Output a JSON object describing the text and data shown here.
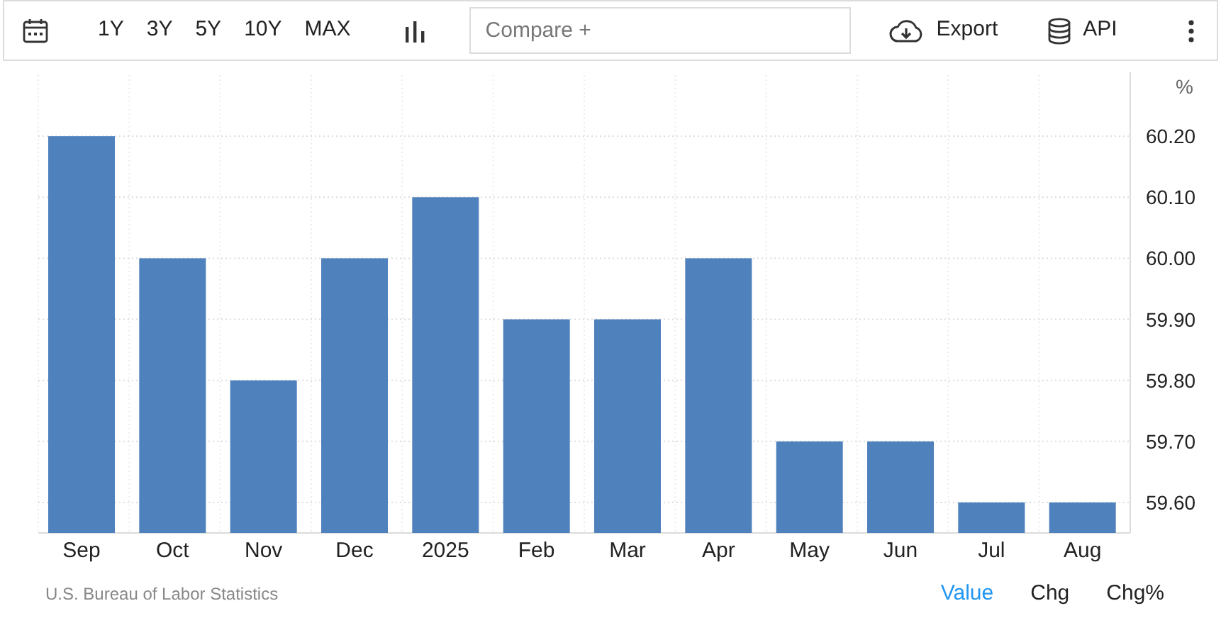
{
  "toolbar": {
    "ranges": [
      {
        "label": "1Y",
        "selected": false
      },
      {
        "label": "3Y",
        "selected": false
      },
      {
        "label": "5Y",
        "selected": false
      },
      {
        "label": "10Y",
        "selected": false
      },
      {
        "label": "MAX",
        "selected": false
      }
    ],
    "compare": {
      "placeholder": "Compare +"
    },
    "export": "Export",
    "api": "API"
  },
  "chart": {
    "unit": "%",
    "chart_data": {
      "type": "bar",
      "categories": [
        "Sep",
        "Oct",
        "Nov",
        "Dec",
        "2025",
        "Feb",
        "Mar",
        "Apr",
        "May",
        "Jun",
        "Jul",
        "Aug"
      ],
      "grid": true,
      "series": [
        {
          "color": "#4f81bd",
          "values": [
            60.2,
            60.0,
            59.8,
            60.0,
            60.1,
            59.9,
            59.9,
            60.0,
            59.7,
            59.7,
            59.6,
            59.6
          ]
        }
      ],
      "ylim": [
        59.55,
        60.3
      ],
      "yticks": [
        {
          "value": 59.6,
          "label": "59.60"
        },
        {
          "value": 59.7,
          "label": "59.70"
        },
        {
          "value": 59.8,
          "label": "59.80"
        },
        {
          "value": 59.9,
          "label": "59.90"
        },
        {
          "value": 60.0,
          "label": "60.00"
        },
        {
          "value": 60.1,
          "label": "60.10"
        },
        {
          "value": 60.2,
          "label": "60.20"
        }
      ]
    }
  },
  "footer": {
    "source": "U.S. Bureau of Labor Statistics",
    "modes": [
      {
        "label": "Value",
        "selected": true
      },
      {
        "label": "Chg",
        "selected": false
      },
      {
        "label": "Chg%",
        "selected": false
      }
    ]
  }
}
